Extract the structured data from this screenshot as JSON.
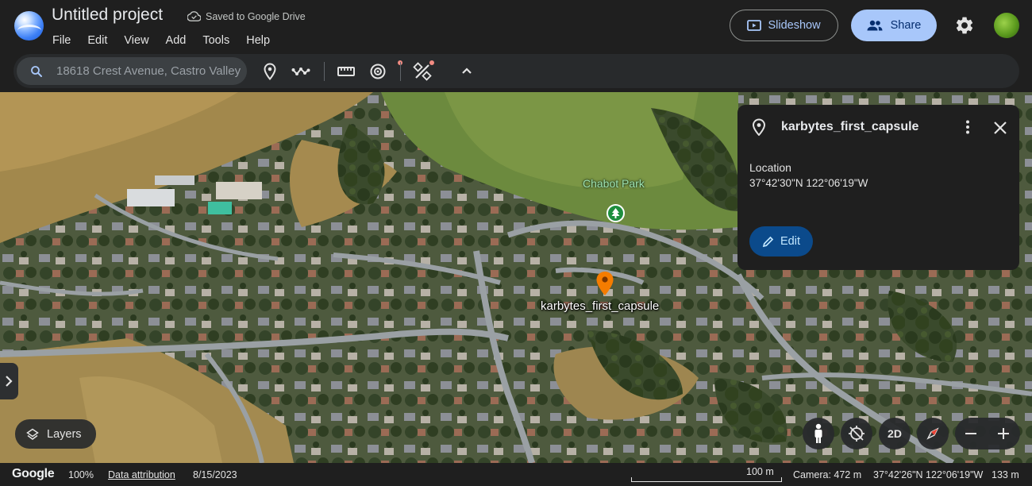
{
  "header": {
    "project_title": "Untitled project",
    "saved_status": "Saved to Google Drive",
    "menu": [
      "File",
      "Edit",
      "View",
      "Add",
      "Tools",
      "Help"
    ],
    "slideshow_label": "Slideshow",
    "share_label": "Share"
  },
  "toolbar": {
    "search_value": "18618 Crest Avenue, Castro Valley",
    "tools": [
      "place-pin-icon",
      "path-icon",
      "measure-icon",
      "rotate-view-icon",
      "wand-icon",
      "chevron-up-icon"
    ]
  },
  "map": {
    "park_label": "Chabot Park",
    "pin_label": "karbytes_first_capsule"
  },
  "info_panel": {
    "title": "karbytes_first_capsule",
    "location_label": "Location",
    "location_value": "37°42'30\"N 122°06'19\"W",
    "edit_label": "Edit"
  },
  "controls": {
    "layers_label": "Layers",
    "view_mode_label": "2D"
  },
  "statusbar": {
    "brand": "Google",
    "zoom_pct": "100%",
    "attribution_label": "Data attribution",
    "imagery_date": "8/15/2023",
    "scale_label": "100 m",
    "camera_altitude": "Camera: 472 m",
    "cursor_coords": "37°42'26\"N 122°06'19\"W",
    "cursor_elevation": "133 m"
  },
  "colors": {
    "accent": "#a8c7fa",
    "edit_button": "#0b4a8b",
    "pin": "#f57c00",
    "park_icon": "#1e8e3e"
  }
}
